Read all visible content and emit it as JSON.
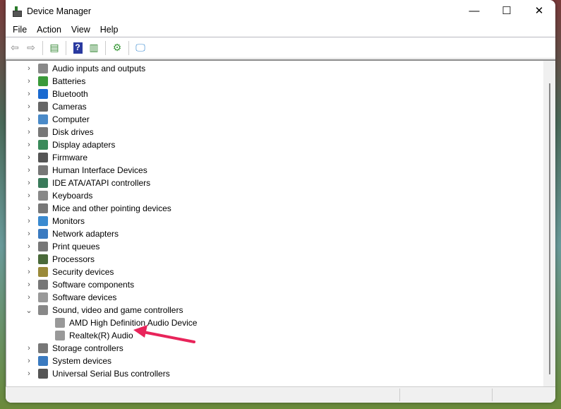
{
  "window": {
    "title": "Device Manager"
  },
  "menu": [
    "File",
    "Action",
    "View",
    "Help"
  ],
  "toolbar": [
    "back",
    "forward",
    "show-hide-console-tree",
    "help",
    "properties",
    "update-driver",
    "scan-hardware"
  ],
  "tree": [
    {
      "label": "Audio inputs and outputs",
      "icon": "speaker-icon",
      "color": "#888"
    },
    {
      "label": "Batteries",
      "icon": "battery-icon",
      "color": "#3a9a3a"
    },
    {
      "label": "Bluetooth",
      "icon": "bluetooth-icon",
      "color": "#1a6ad0"
    },
    {
      "label": "Cameras",
      "icon": "camera-icon",
      "color": "#666"
    },
    {
      "label": "Computer",
      "icon": "computer-icon",
      "color": "#4a8ac8"
    },
    {
      "label": "Disk drives",
      "icon": "disk-icon",
      "color": "#777"
    },
    {
      "label": "Display adapters",
      "icon": "display-adapter-icon",
      "color": "#3a8a5a"
    },
    {
      "label": "Firmware",
      "icon": "firmware-icon",
      "color": "#555"
    },
    {
      "label": "Human Interface Devices",
      "icon": "hid-icon",
      "color": "#777"
    },
    {
      "label": "IDE ATA/ATAPI controllers",
      "icon": "ide-icon",
      "color": "#3a7a5a"
    },
    {
      "label": "Keyboards",
      "icon": "keyboard-icon",
      "color": "#888"
    },
    {
      "label": "Mice and other pointing devices",
      "icon": "mouse-icon",
      "color": "#777"
    },
    {
      "label": "Monitors",
      "icon": "monitor-icon",
      "color": "#3a8ad0"
    },
    {
      "label": "Network adapters",
      "icon": "network-icon",
      "color": "#3a7ac0"
    },
    {
      "label": "Print queues",
      "icon": "printer-icon",
      "color": "#777"
    },
    {
      "label": "Processors",
      "icon": "processor-icon",
      "color": "#4a6a3a"
    },
    {
      "label": "Security devices",
      "icon": "security-icon",
      "color": "#9a8a3a"
    },
    {
      "label": "Software components",
      "icon": "software-component-icon",
      "color": "#777"
    },
    {
      "label": "Software devices",
      "icon": "software-device-icon",
      "color": "#999"
    },
    {
      "label": "Sound, video and game controllers",
      "icon": "speaker-icon",
      "color": "#888",
      "expanded": true,
      "children": [
        {
          "label": "AMD High Definition Audio Device"
        },
        {
          "label": "Realtek(R) Audio",
          "highlighted_by_arrow": true
        }
      ]
    },
    {
      "label": "Storage controllers",
      "icon": "storage-icon",
      "color": "#777"
    },
    {
      "label": "System devices",
      "icon": "system-icon",
      "color": "#3a7ac0"
    },
    {
      "label": "Universal Serial Bus controllers",
      "icon": "usb-icon",
      "color": "#555"
    }
  ],
  "annotation_color": "#e8245a"
}
